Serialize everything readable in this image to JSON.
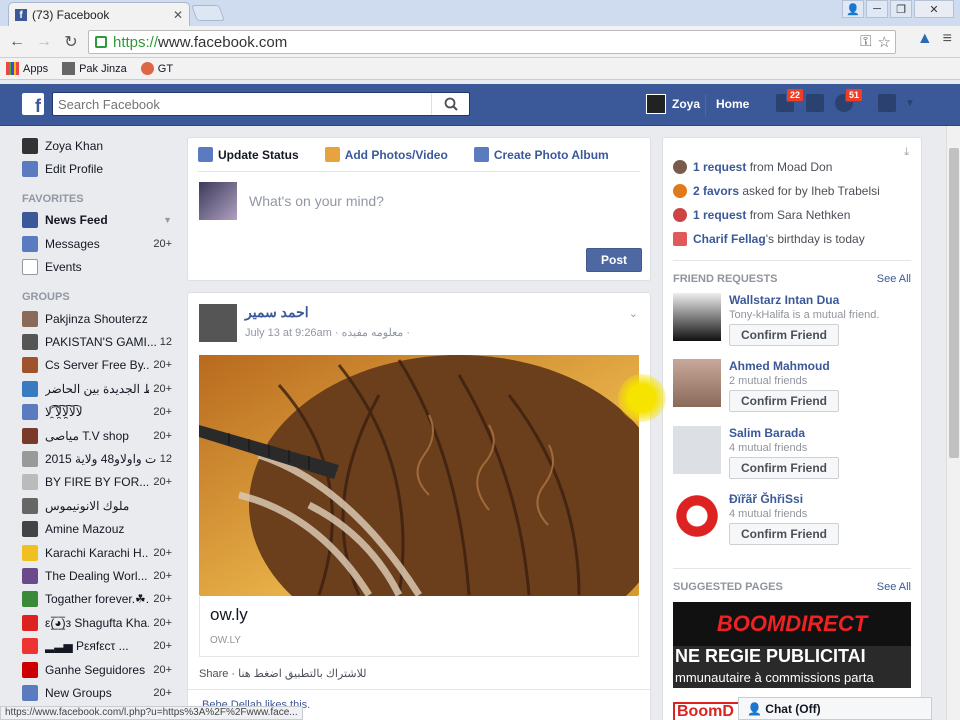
{
  "browser": {
    "tab_title": "(73) Facebook",
    "url_scheme": "https://",
    "url_rest": "www.facebook.com",
    "bookmarks": [
      "Apps",
      "Pak Jinza",
      "GT"
    ]
  },
  "header": {
    "search_placeholder": "Search Facebook",
    "user_name": "Zoya",
    "home_label": "Home",
    "friend_badge": "22",
    "notif_badge": "51"
  },
  "sidebar": {
    "profile_name": "Zoya Khan",
    "edit_profile": "Edit Profile",
    "favorites_title": "FAVORITES",
    "favorites": [
      {
        "label": "News Feed",
        "count": ""
      },
      {
        "label": "Messages",
        "count": "20+"
      },
      {
        "label": "Events",
        "count": ""
      }
    ],
    "groups_title": "GROUPS",
    "groups": [
      {
        "label": "Pakjinza Shouterzz",
        "count": ""
      },
      {
        "label": "PAKISTAN'S GAMI...",
        "count": "12"
      },
      {
        "label": "Cs Server Free By...",
        "count": "20+"
      },
      {
        "label": "دمياط الجديدة بين الحاضر",
        "count": "20+"
      },
      {
        "label": "ﻻ͡ﻻ̯͡ﻻ̯͡ﻻ͡ ̯͡ﻻ",
        "count": "20+"
      },
      {
        "label": "مياصى T.V shop",
        "count": "20+"
      },
      {
        "label": "بنات واولاو48 ولاية 2015",
        "count": "12"
      },
      {
        "label": "BY FIRE BY FOR...",
        "count": "20+"
      },
      {
        "label": "ملوك الانونيموس",
        "count": ""
      },
      {
        "label": "Amine Mazouz",
        "count": ""
      },
      {
        "label": "Karachi Karachi H...",
        "count": "20+"
      },
      {
        "label": "The Dealing Worl...",
        "count": "20+"
      },
      {
        "label": "Togather forever.☘...",
        "count": "20+"
      },
      {
        "label": "ε(̲̅◕̲̅)з Shagufta Kha...",
        "count": "20+"
      },
      {
        "label": "▂▃▅ Pεяfεcτ ...",
        "count": "20+"
      },
      {
        "label": "Ganhe Seguidores",
        "count": "20+"
      },
      {
        "label": "New Groups",
        "count": "20+"
      }
    ]
  },
  "composer": {
    "tab_status": "Update Status",
    "tab_photos": "Add Photos/Video",
    "tab_album": "Create Photo Album",
    "placeholder": "What's on your mind?",
    "post_label": "Post"
  },
  "story": {
    "author": "احمد سمير",
    "meta": "July 13 at 9:26am · معلومه مفيده ·",
    "link_title": "ow.ly",
    "link_domain": "OW.LY",
    "footer": "Share · للاشتراك بالتطبيق اضغط هنا",
    "likes": "Bebe Dellah likes this."
  },
  "right": {
    "notifications": [
      {
        "bold": "1 request",
        "rest": " from Moad Don"
      },
      {
        "bold": "2 favors",
        "rest": " asked for by Iheb Trabelsi"
      },
      {
        "bold": "1 request",
        "rest": " from Sara Nethken"
      },
      {
        "bold": "Charif Fellag",
        "rest": "'s birthday is today"
      }
    ],
    "friend_requests_title": "FRIEND REQUESTS",
    "see_all": "See All",
    "confirm_label": "Confirm Friend",
    "requests": [
      {
        "name": "Wallstarz Intan Dua",
        "sub": "Tony-kHalifa is a mutual friend."
      },
      {
        "name": "Ahmed Mahmoud",
        "sub": "2 mutual friends"
      },
      {
        "name": "Salim Barada",
        "sub": "4 mutual friends"
      },
      {
        "name": "Ðïřãř ĞhřiSsi",
        "sub": "4 mutual friends"
      }
    ],
    "suggested_title": "SUGGESTED PAGES",
    "ad_brand": "BOOMDIRECT",
    "ad_line1": "NE REGIE PUBLICITAI",
    "ad_line2": "mmunautaire à commissions parta",
    "ad_bottom": "BoomD"
  },
  "status_url": "https://www.facebook.com/l.php?u=https%3A%2F%2Fwww.face...",
  "chat_label": "Chat (Off)"
}
